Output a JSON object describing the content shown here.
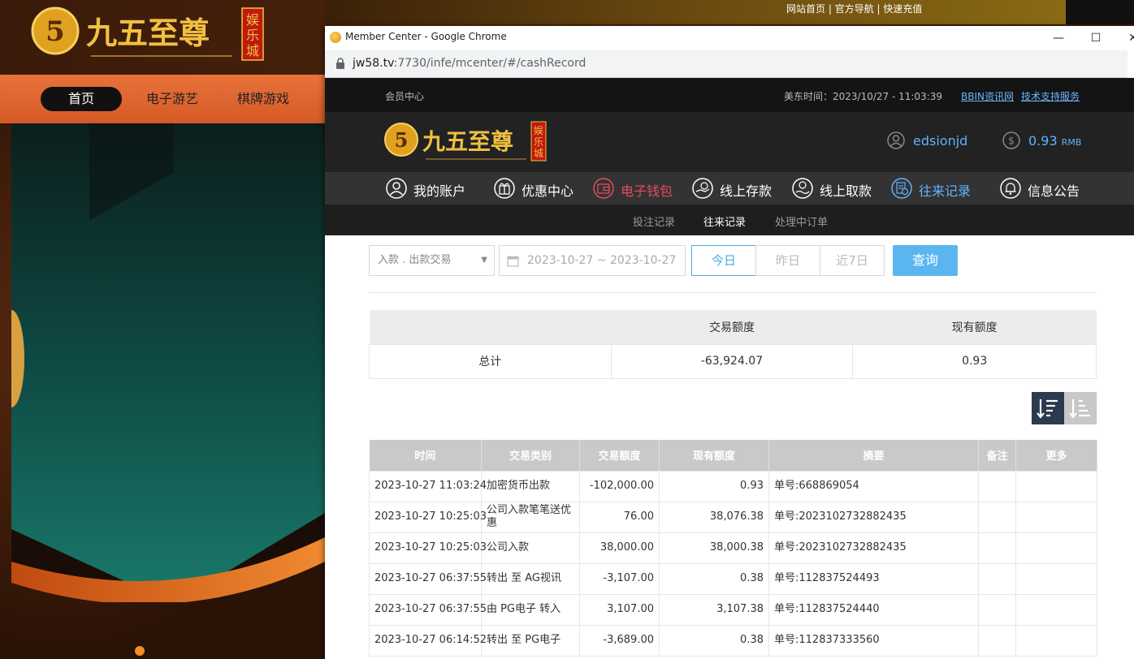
{
  "background_site": {
    "top_links": "网站首页 | 官方导航 | 快速充值",
    "nav": [
      "首页",
      "电子游艺",
      "棋牌游戏"
    ]
  },
  "window": {
    "title": "Member Center - Google Chrome",
    "controls": [
      "—",
      "☐",
      "✕"
    ],
    "url_host": "jw58.tv",
    "url_rest": ":7730/infe/mcenter/#/cashRecord"
  },
  "member_center": {
    "top_label": "会员中心",
    "us_time": "美东时间：2023/10/27 - 11:03:39",
    "links": [
      "BBIN资讯网",
      "技术支持服务"
    ],
    "username": "edsionjd",
    "balance": "0.93",
    "currency": "RMB",
    "nav": [
      {
        "label": "我的账户",
        "icon": "user-icon"
      },
      {
        "label": "优惠中心",
        "icon": "gift-icon"
      },
      {
        "label": "电子钱包",
        "icon": "wallet-icon"
      },
      {
        "label": "线上存款",
        "icon": "deposit-icon"
      },
      {
        "label": "线上取款",
        "icon": "withdraw-icon"
      },
      {
        "label": "往来记录",
        "icon": "records-icon"
      },
      {
        "label": "信息公告",
        "icon": "bell-icon"
      }
    ],
    "subnav": [
      "投注记录",
      "往来记录",
      "处理中订单"
    ]
  },
  "filters": {
    "type_select": "入款 . 出款交易",
    "date_range": "2023-10-27 ~ 2023-10-27",
    "ranges": [
      "今日",
      "昨日",
      "近7日"
    ],
    "query": "查询"
  },
  "summary": {
    "headers": [
      "",
      "交易额度",
      "现有额度"
    ],
    "row": [
      "总计",
      "-63,924.07",
      "0.93"
    ]
  },
  "records": {
    "headers": [
      "时间",
      "交易类别",
      "交易额度",
      "现有额度",
      "摘要",
      "备注",
      "更多"
    ],
    "rows": [
      [
        "2023-10-27 11:03:24",
        "加密货币出款",
        "-102,000.00",
        "0.93",
        "单号:668869054",
        "",
        ""
      ],
      [
        "2023-10-27 10:25:03",
        "公司入款笔笔送优惠",
        "76.00",
        "38,076.38",
        "单号:2023102732882435",
        "",
        ""
      ],
      [
        "2023-10-27 10:25:03",
        "公司入款",
        "38,000.00",
        "38,000.38",
        "单号:2023102732882435",
        "",
        ""
      ],
      [
        "2023-10-27 06:37:55",
        "转出 至 AG视讯",
        "-3,107.00",
        "0.38",
        "单号:112837524493",
        "",
        ""
      ],
      [
        "2023-10-27 06:37:55",
        "由 PG电子 转入",
        "3,107.00",
        "3,107.38",
        "单号:112837524440",
        "",
        ""
      ],
      [
        "2023-10-27 06:14:52",
        "转出 至 PG电子",
        "-3,689.00",
        "0.38",
        "单号:112837333560",
        "",
        ""
      ]
    ]
  },
  "colors": {
    "accent_blue": "#5bb6f0",
    "link_blue": "#5fb3ff",
    "wallet_red": "#e84a5f",
    "header_dark": "#222222"
  }
}
